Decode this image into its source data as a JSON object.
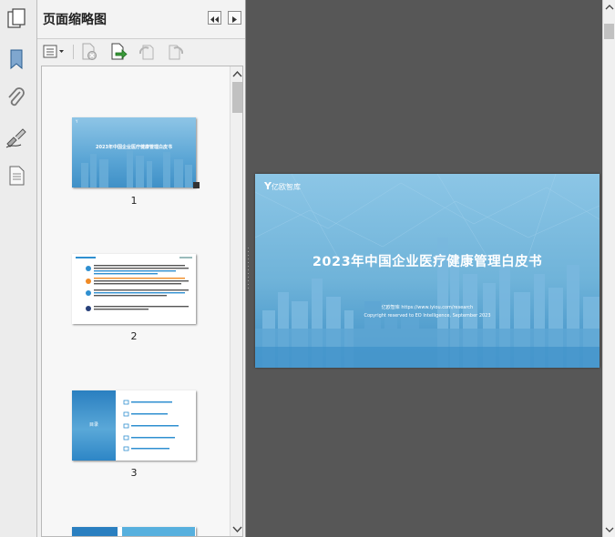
{
  "panel": {
    "title": "页面缩略图"
  },
  "thumbnails": [
    {
      "page": "1",
      "title": "2023年中国企业医疗健康管理白皮书"
    },
    {
      "page": "2"
    },
    {
      "page": "3",
      "cover_label": "目录"
    }
  ],
  "document": {
    "logo_text": "亿欧智库",
    "title": "2023年中国企业医疗健康管理白皮书",
    "site_line": "亿欧智库 https://www.iyiou.com/research",
    "copyright_line": "Copyright reserved to EO Intelligence, September 2023"
  },
  "colors": {
    "accent": "#2f8fd0",
    "sky": "#6fb3d9",
    "background": "#575757"
  },
  "icons": [
    "pages-icon",
    "bookmark-icon",
    "attachment-icon",
    "signature-icon",
    "layers-icon",
    "options-icon",
    "delete-page-icon",
    "insert-page-icon",
    "rotate-left-icon",
    "rotate-right-icon"
  ]
}
